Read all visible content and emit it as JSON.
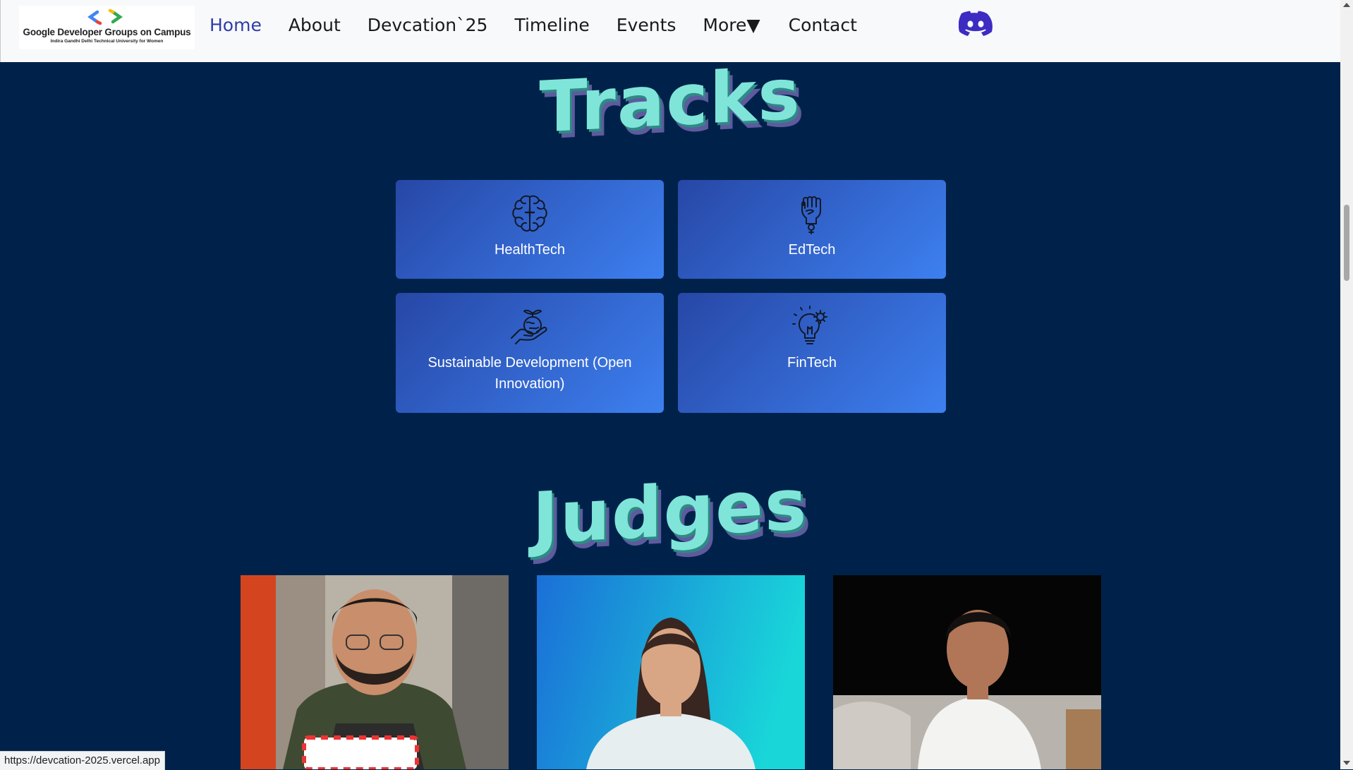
{
  "navbar": {
    "logo": {
      "title": "Google Developer Groups on Campus",
      "subtitle": "Indira Gandhi Delhi Technical University for Women"
    },
    "links": [
      {
        "label": "Home",
        "active": true
      },
      {
        "label": "About"
      },
      {
        "label": "Devcation`25"
      },
      {
        "label": "Timeline"
      },
      {
        "label": "Events"
      },
      {
        "label": "More▼"
      },
      {
        "label": "Contact"
      }
    ],
    "discord_icon": "discord-icon"
  },
  "tracks": {
    "title": "Tracks",
    "items": [
      {
        "label": "HealthTech",
        "icon": "brain-icon"
      },
      {
        "label": "EdTech",
        "icon": "raised-fist-icon"
      },
      {
        "label": "Sustainable Development (Open Innovation)",
        "icon": "hand-plant-icon"
      },
      {
        "label": "FinTech",
        "icon": "lightbulb-gear-icon"
      }
    ]
  },
  "judges": {
    "title": "Judges",
    "photos": [
      "judge-photo-1",
      "judge-photo-2",
      "judge-photo-3"
    ]
  },
  "status_bar": {
    "url": "https://devcation-2025.vercel.app"
  },
  "colors": {
    "page_background": "#00224a",
    "navbar_background": "#f8f9fb",
    "nav_active": "#2e3ca8",
    "title_fill": "#7fe5d9",
    "title_shadow": "#5e5a9e",
    "card_gradient_start": "#2747a6",
    "card_gradient_end": "#3d80f0"
  }
}
